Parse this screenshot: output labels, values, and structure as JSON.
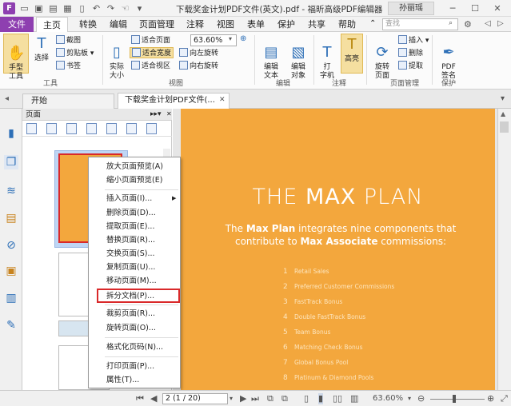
{
  "window": {
    "title": "下载奖金计划PDF文件(英文).pdf - 福昕高级PDF编辑器",
    "user": "孙丽瑶"
  },
  "menu_tabs": [
    "文件",
    "主页",
    "转换",
    "编辑",
    "页面管理",
    "注释",
    "视图",
    "表单",
    "保护",
    "共享",
    "帮助"
  ],
  "search": {
    "placeholder": "查找"
  },
  "ribbon": {
    "tools": {
      "label": "工具",
      "hand": "手型\n工具",
      "select": "选择",
      "snapshot": "截图",
      "clipboard": "剪贴板",
      "bookmark": "书签"
    },
    "view": {
      "label": "视图",
      "actual_size": "实际\n大小",
      "fit_page": "适合页面",
      "fit_width": "适合宽度",
      "fit_visible": "适合视区",
      "zoom": "63.60%",
      "rotate_left": "向左旋转",
      "rotate_right": "向右旋转"
    },
    "edit": {
      "label": "编辑",
      "edit_text": "编辑\n文本",
      "edit_object": "编辑\n对象"
    },
    "comment": {
      "label": "注释",
      "typewriter": "打\n字机",
      "highlight": "高亮"
    },
    "pages": {
      "label": "页面管理",
      "rotate_page": "旋转\n页面",
      "insert": "插入",
      "delete": "删除",
      "extract": "提取"
    },
    "protect": {
      "label": "保护",
      "pdf_sign": "PDF\n签名"
    }
  },
  "doc_tabs": {
    "start": "开始",
    "current": "下载奖金计划PDF文件(..."
  },
  "panel": {
    "title": "页面"
  },
  "context_menu": [
    "放大页面预览(A)",
    "缩小页面预览(E)",
    "插入页面(I)...",
    "删除页面(D)...",
    "提取页面(E)...",
    "替换页面(R)...",
    "交换页面(S)...",
    "复制页面(U)...",
    "移动页面(M)...",
    "拆分文档(P)...",
    "裁剪页面(R)...",
    "旋转页面(O)...",
    "格式化页码(N)...",
    "打印页面(P)...",
    "属性(T)..."
  ],
  "document": {
    "heading_light_1": "THE ",
    "heading_bold": "MAX",
    "heading_light_2": " PLAN",
    "sub_1": "The ",
    "sub_bold_1": "Max Plan",
    "sub_2": " integrates nine components that contribute to ",
    "sub_bold_2": "Max Associate",
    "sub_3": " commissions:",
    "list": [
      {
        "n": "1",
        "text": "Retail Sales"
      },
      {
        "n": "2",
        "text": "Preferred Customer Commissions"
      },
      {
        "n": "3",
        "text": "FastTrack Bonus"
      },
      {
        "n": "4",
        "text": "Double FastTrack Bonus"
      },
      {
        "n": "5",
        "text": "Team Bonus"
      },
      {
        "n": "6",
        "text": "Matching Check Bonus"
      },
      {
        "n": "7",
        "text": "Global Bonus Pool"
      },
      {
        "n": "8",
        "text": "Platinum & Diamond Pools"
      }
    ]
  },
  "status": {
    "page": "2 (1 / 20)",
    "zoom": "63.60%"
  },
  "colors": {
    "accent": "#8e3fb0",
    "page_bg": "#f3a73d",
    "highlight_box": "#d9292a"
  }
}
